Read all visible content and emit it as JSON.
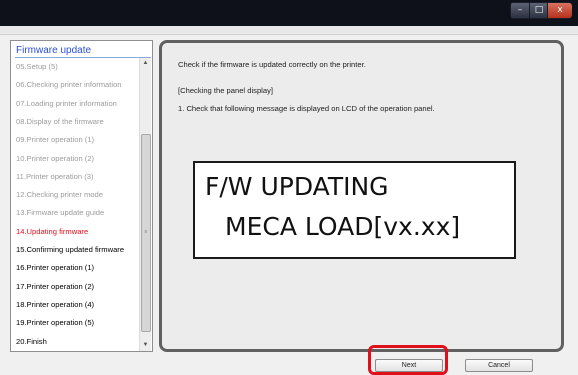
{
  "window": {
    "minimize_glyph": "–",
    "maximize_glyph": "□",
    "close_glyph": "x"
  },
  "sidebar": {
    "title": "Firmware update",
    "items": [
      {
        "label": "05.Setup (5)",
        "state": "done"
      },
      {
        "label": "06.Checking printer information",
        "state": "done"
      },
      {
        "label": "07.Loading printer information",
        "state": "done"
      },
      {
        "label": "08.Display of the firmware",
        "state": "done"
      },
      {
        "label": "09.Printer operation (1)",
        "state": "done"
      },
      {
        "label": "10.Printer operation (2)",
        "state": "done"
      },
      {
        "label": "11.Printer operation (3)",
        "state": "done"
      },
      {
        "label": "12.Checking printer mode",
        "state": "done"
      },
      {
        "label": "13.Firmware update guide",
        "state": "done"
      },
      {
        "label": "14.Updating firmware",
        "state": "current"
      },
      {
        "label": "15.Confirming updated firmware",
        "state": "todo"
      },
      {
        "label": "16.Printer operation (1)",
        "state": "todo"
      },
      {
        "label": "17.Printer operation (2)",
        "state": "todo"
      },
      {
        "label": "18.Printer operation (4)",
        "state": "todo"
      },
      {
        "label": "19.Printer operation (5)",
        "state": "todo"
      },
      {
        "label": "20.Finish",
        "state": "todo"
      }
    ],
    "scroll_up_glyph": "▲",
    "scroll_down_glyph": "▼",
    "scroll_grip_glyph": "≡"
  },
  "content": {
    "intro": "Check if the firmware is updated correctly on the printer.",
    "section_heading": "[Checking the panel display]",
    "step_1": "1.  Check that following message is displayed on LCD of the operation panel.",
    "lcd_line_1": "F/W UPDATING",
    "lcd_line_2": "MECA LOAD[vx.xx]"
  },
  "footer": {
    "next_label": "Next",
    "cancel_label": "Cancel"
  },
  "colors": {
    "current_step": "#e0101b",
    "completed_step": "#9c9c9c",
    "sidebar_title": "#2a4fd6",
    "highlight_box": "#e0101b"
  }
}
